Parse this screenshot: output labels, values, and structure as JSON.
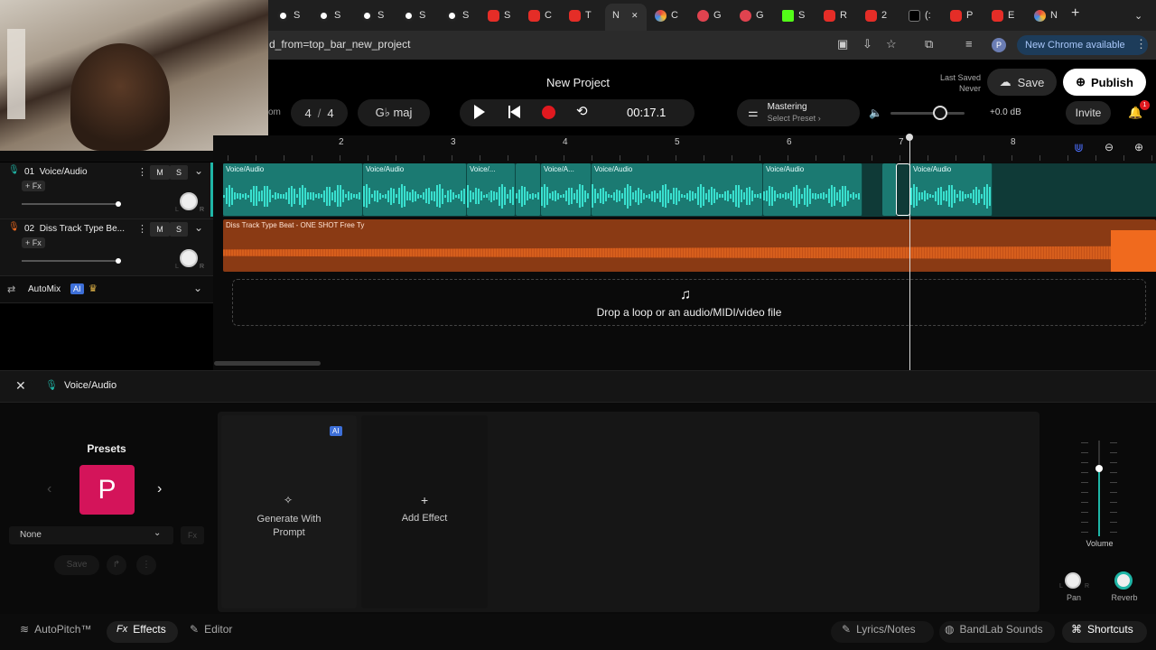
{
  "browser": {
    "tabs": [
      {
        "icon": "bandlab-icon",
        "label": "S"
      },
      {
        "icon": "bandlab-icon",
        "label": "S"
      },
      {
        "icon": "bandlab-icon",
        "label": "S"
      },
      {
        "icon": "bandlab-icon",
        "label": "S"
      },
      {
        "icon": "bandlab-icon",
        "label": "S"
      },
      {
        "icon": "youtube-icon",
        "label": "S"
      },
      {
        "icon": "youtube-icon",
        "label": "C"
      },
      {
        "icon": "youtube-icon",
        "label": "T"
      },
      {
        "icon": "none",
        "label": "N"
      },
      {
        "icon": "color-icon",
        "label": "C"
      },
      {
        "icon": "red-icon",
        "label": "G"
      },
      {
        "icon": "red-icon",
        "label": "G"
      },
      {
        "icon": "kick-icon",
        "label": "S"
      },
      {
        "icon": "youtube-icon",
        "label": "R"
      },
      {
        "icon": "youtube-icon",
        "label": "2"
      },
      {
        "icon": "x-icon",
        "label": "(:"
      },
      {
        "icon": "youtube-icon",
        "label": "P"
      },
      {
        "icon": "youtube-icon",
        "label": "E"
      },
      {
        "icon": "globe-icon",
        "label": "N"
      }
    ],
    "url": "d_from=top_bar_new_project",
    "new_chrome_label": "New Chrome available"
  },
  "header": {
    "project_title": "New Project",
    "last_saved_label": "Last Saved",
    "last_saved_value": "Never",
    "save_label": "Save",
    "publish_label": "Publish",
    "bpm_fragment": "om",
    "time_signature_num": "4",
    "time_signature_den": "4",
    "key": "G♭ maj",
    "time": "00:17.1",
    "mastering_label": "Mastering",
    "mastering_preset": "Select Preset",
    "master_volume": "+0.0 dB",
    "invite_label": "Invite",
    "notification_count": "1"
  },
  "ruler": [
    "2",
    "3",
    "4",
    "5",
    "6",
    "7",
    "8"
  ],
  "tracks": [
    {
      "number": "01",
      "name": "Voice/Audio",
      "fx": "+ Fx",
      "mute": "M",
      "solo": "S",
      "pan_l": "L",
      "pan_r": "R",
      "color": "#1fb5a6"
    },
    {
      "number": "02",
      "name": "Diss Track Type Be...",
      "fx": "+ Fx",
      "mute": "M",
      "solo": "S",
      "pan_l": "L",
      "pan_r": "R",
      "color": "#f06a1e"
    }
  ],
  "automix": {
    "label": "AutoMix",
    "badge": "AI"
  },
  "clips": {
    "voice": [
      "Voice/Audio",
      "Voice/Audio",
      "Voice/...",
      "Voice/A...",
      "Voice/Audio",
      "Voice/Audio",
      "Voice/Audio"
    ],
    "beat": "Diss Track Type Beat - ONE SHOT  Free Ty"
  },
  "dropzone": "Drop a loop or an audio/MIDI/video file",
  "editor": {
    "track_name": "Voice/Audio",
    "presets_title": "Presets",
    "preset_letter": "P",
    "preset_select": "None",
    "preset_fx": "Fx",
    "save_label": "Save",
    "generate_label_1": "Generate With",
    "generate_label_2": "Prompt",
    "ai_badge": "AI",
    "add_effect": "Add Effect",
    "volume_label": "Volume",
    "pan_label": "Pan",
    "reverb_label": "Reverb",
    "pan_l": "L",
    "pan_r": "R"
  },
  "bottom": {
    "autopitch": "AutoPitch™",
    "effects": "Effects",
    "effects_prefix": "Fx",
    "editor": "Editor",
    "lyrics": "Lyrics/Notes",
    "sounds": "BandLab Sounds",
    "shortcuts": "Shortcuts"
  }
}
